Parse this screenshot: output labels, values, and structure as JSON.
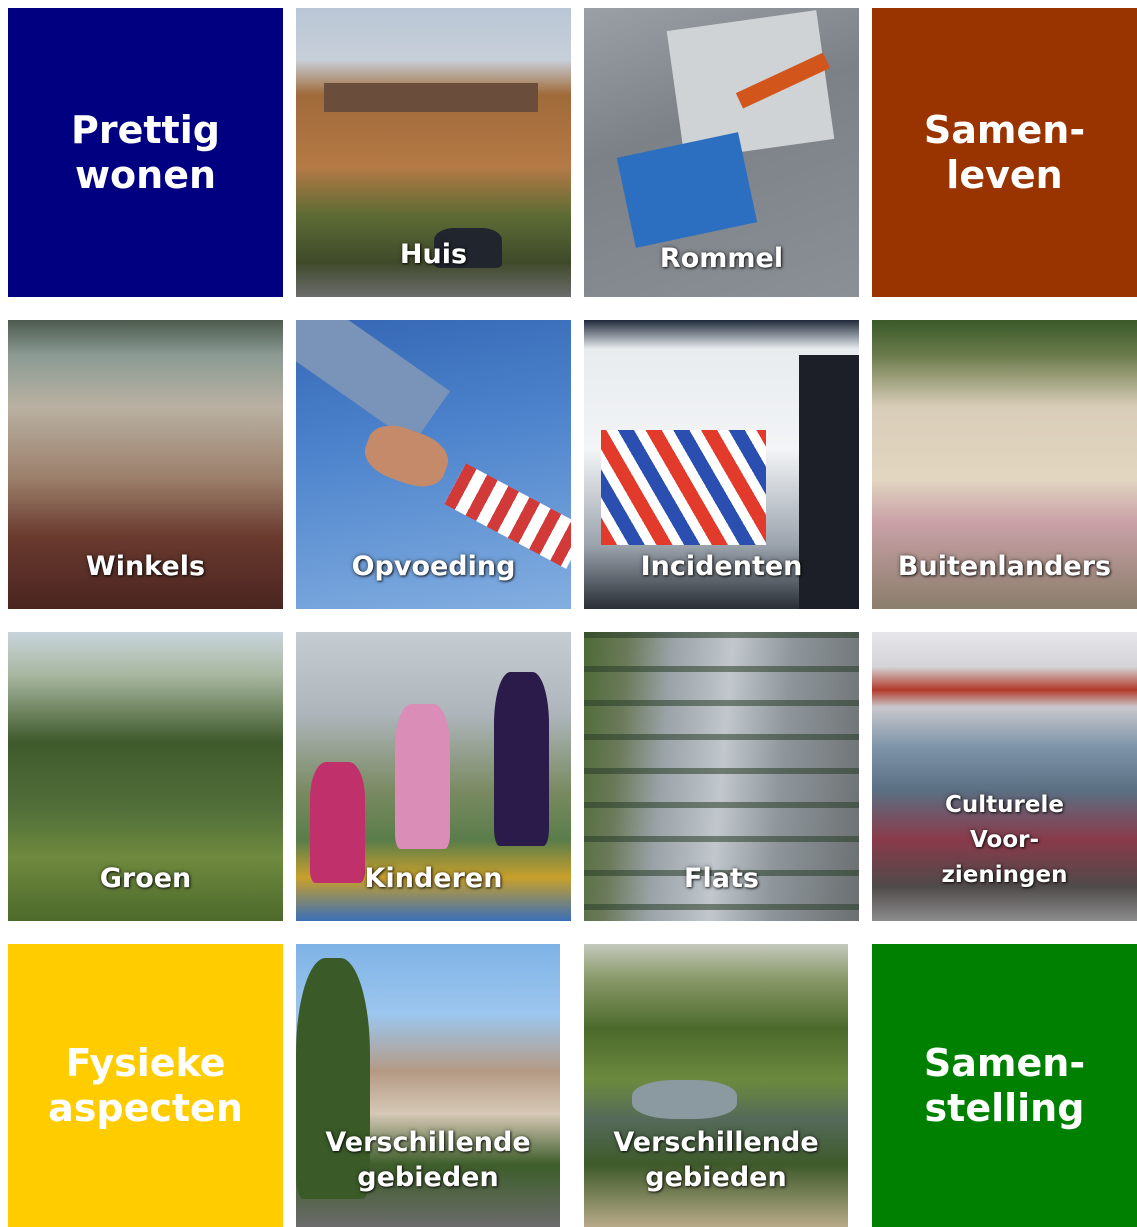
{
  "tiles": {
    "prettig_wonen": {
      "lines": [
        "Prettig",
        "wonen"
      ],
      "color": "#000080"
    },
    "huis": {
      "lines": [
        "Huis"
      ]
    },
    "rommel": {
      "lines": [
        "Rommel"
      ]
    },
    "samenleven": {
      "lines": [
        "Samen-",
        "leven"
      ],
      "color": "#993300"
    },
    "winkels": {
      "lines": [
        "Winkels"
      ]
    },
    "opvoeding": {
      "lines": [
        "Opvoeding"
      ]
    },
    "incidenten": {
      "lines": [
        "Incidenten"
      ]
    },
    "buitenlanders": {
      "lines": [
        "Buitenlanders"
      ]
    },
    "groen": {
      "lines": [
        "Groen"
      ]
    },
    "kinderen": {
      "lines": [
        "Kinderen"
      ]
    },
    "flats": {
      "lines": [
        "Flats"
      ]
    },
    "culturele_voorzieningen": {
      "lines": [
        "Culturele",
        "Voor-",
        "zieningen"
      ]
    },
    "fysieke_aspecten": {
      "lines": [
        "Fysieke",
        "aspecten"
      ],
      "color": "#ffcc00"
    },
    "verschillende_gebieden_1": {
      "lines": [
        "Verschillende",
        "gebieden"
      ]
    },
    "verschillende_gebieden_2": {
      "lines": [
        "Verschillende",
        "gebieden"
      ]
    },
    "samenstelling": {
      "lines": [
        "Samen-",
        "stelling"
      ],
      "color": "#008000"
    }
  }
}
